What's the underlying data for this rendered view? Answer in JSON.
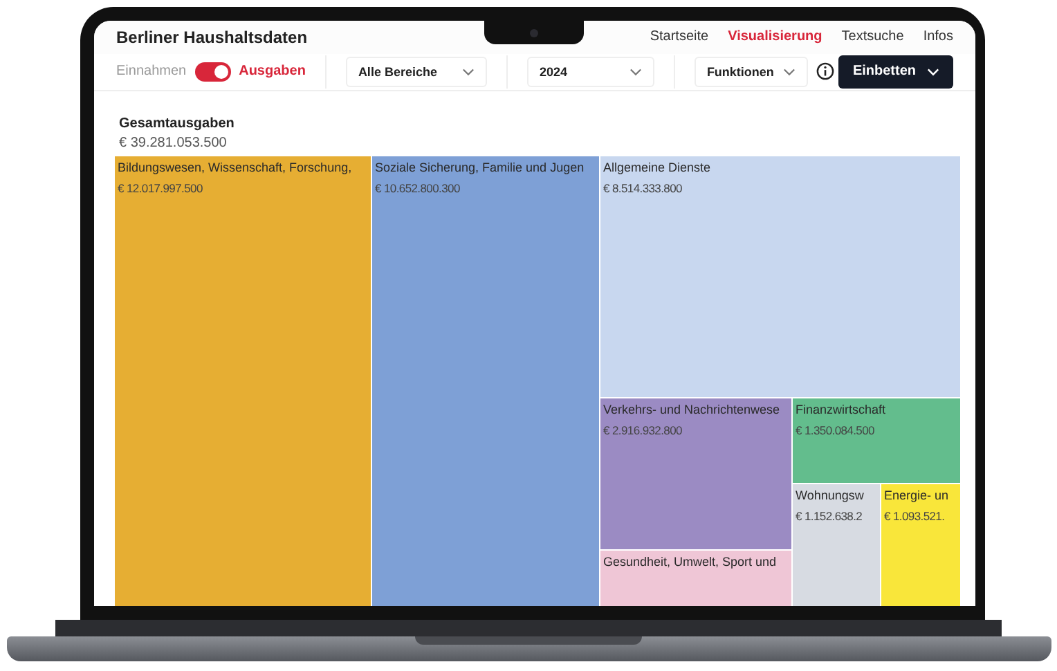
{
  "app": {
    "title": "Berliner Haushaltsdaten"
  },
  "nav": [
    {
      "label": "Startseite",
      "selected": false
    },
    {
      "label": "Visualisierung",
      "selected": true
    },
    {
      "label": "Textsuche",
      "selected": false
    },
    {
      "label": "Infos",
      "selected": false
    }
  ],
  "toolbar": {
    "toggle_left": "Einnahmen",
    "toggle_right": "Ausgaben",
    "toggle_on": true,
    "dropdowns": [
      {
        "value": "Alle Bereiche"
      },
      {
        "value": "2024"
      },
      {
        "value": "Funktionen"
      }
    ],
    "embed_button": "Einbetten"
  },
  "summary": {
    "title": "Gesamtausgaben",
    "value": "€ 39.281.053.500"
  },
  "treemap": {
    "tiles": [
      {
        "label": "Bildungswesen, Wissenschaft, Forschung,",
        "value": "€ 12.017.997.500",
        "color": "#e6ae33"
      },
      {
        "label": "Soziale Sicherung, Familie und Jugen",
        "value": "€ 10.652.800.300",
        "color": "#7ea0d6"
      },
      {
        "label": "Allgemeine Dienste",
        "value": "€ 8.514.333.800",
        "color": "#c8d7ef"
      },
      {
        "label": "Verkehrs- und Nachrichtenwese",
        "value": "€ 2.916.932.800",
        "color": "#9b8bc3"
      },
      {
        "label": "Gesundheit, Umwelt, Sport und",
        "color": "#efc6d6"
      },
      {
        "label": "Finanzwirtschaft",
        "value": "€ 1.350.084.500",
        "color": "#63bd8d"
      },
      {
        "label": "Wohnungsw",
        "value": "€ 1.152.638.2",
        "color": "#d7dbe2"
      },
      {
        "label": "Energie- un",
        "value": "€ 1.093.521.",
        "color": "#f9e63a"
      }
    ]
  }
}
